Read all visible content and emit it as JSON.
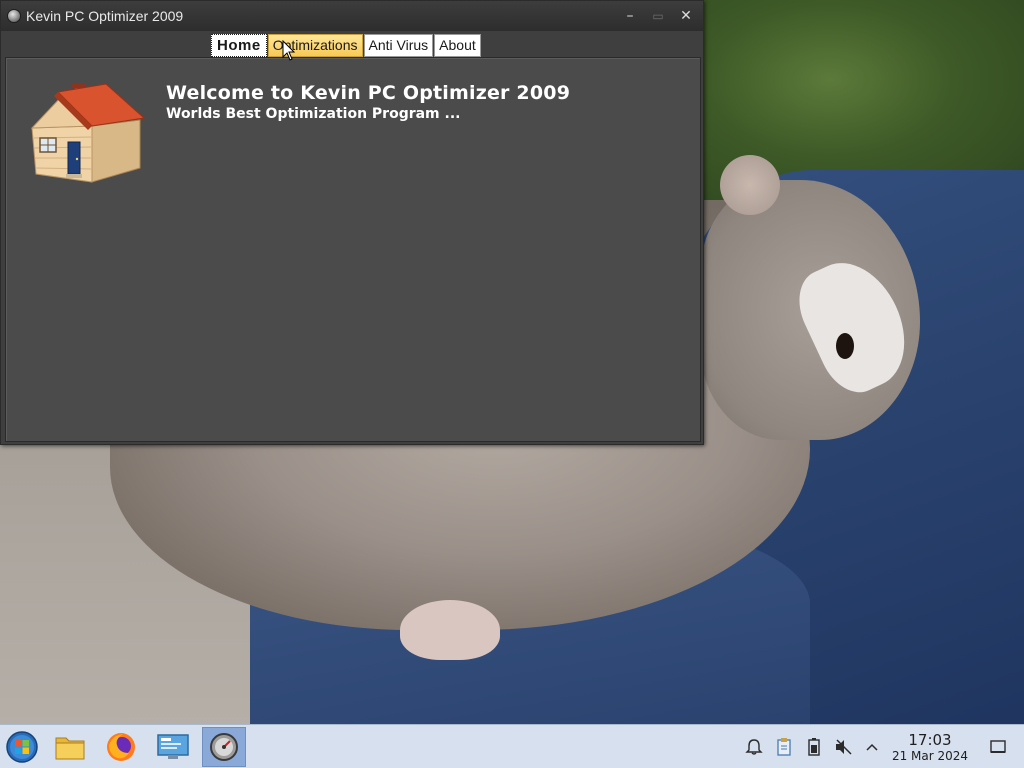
{
  "window": {
    "title": "Kevin PC Optimizer 2009",
    "controls": {
      "minimize": "–",
      "maximize": "▭",
      "close": "✕"
    }
  },
  "tabs": [
    {
      "label": "Home",
      "state": "active"
    },
    {
      "label": "Optimizations",
      "state": "hover"
    },
    {
      "label": "Anti Virus",
      "state": "normal"
    },
    {
      "label": "About",
      "state": "normal"
    }
  ],
  "home": {
    "welcome_title": "Welcome to Kevin PC Optimizer 2009",
    "welcome_subtitle": "Worlds Best Optimization Program ...",
    "icon": "house-icon"
  },
  "taskbar": {
    "start_icon": "start-orb-icon",
    "pinned": [
      {
        "name": "file-manager-icon"
      },
      {
        "name": "firefox-icon"
      },
      {
        "name": "control-panel-icon"
      },
      {
        "name": "optimizer-app-icon",
        "active": true
      }
    ],
    "tray": [
      {
        "name": "notification-bell-icon"
      },
      {
        "name": "clipboard-icon"
      },
      {
        "name": "battery-icon"
      },
      {
        "name": "volume-muted-icon"
      },
      {
        "name": "tray-expand-icon"
      }
    ],
    "clock": {
      "time": "17:03",
      "date": "21 Mar 2024"
    },
    "show_desktop_icon": "show-desktop-icon"
  },
  "colors": {
    "window_bg": "#4b4b4b",
    "titlebar": "#2d2d2d",
    "tab_hover": "#f8c955",
    "taskbar_bg": "#d6e0ee",
    "active_task": "#8aa9d8"
  }
}
